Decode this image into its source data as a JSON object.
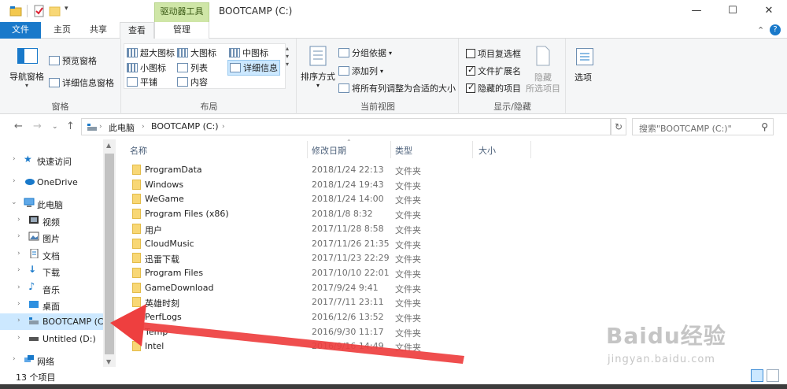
{
  "titlebar": {
    "context_tool": "驱动器工具",
    "title": "BOOTCAMP (C:)",
    "minimize_icon": "minimize-icon",
    "maximize_icon": "maximize-icon",
    "close_icon": "close-icon"
  },
  "tabs": {
    "file": "文件",
    "home": "主页",
    "share": "共享",
    "view": "查看",
    "manage": "管理"
  },
  "ribbon": {
    "panes": {
      "nav_pane": "导航窗格",
      "preview_pane": "预览窗格",
      "details_pane": "详细信息窗格",
      "label": "窗格"
    },
    "layout": {
      "extra_large": "超大图标",
      "large": "大图标",
      "medium": "中图标",
      "small": "小图标",
      "list": "列表",
      "details": "详细信息",
      "tiles": "平铺",
      "content": "内容",
      "label": "布局"
    },
    "current_view": {
      "sort_by": "排序方式",
      "group_by": "分组依据",
      "add_columns": "添加列",
      "fit_columns": "将所有列调整为合适的大小",
      "label": "当前视图"
    },
    "show_hide": {
      "item_checkboxes": "项目复选框",
      "item_checkboxes_checked": false,
      "file_extensions": "文件扩展名",
      "file_extensions_checked": true,
      "hidden_items": "隐藏的项目",
      "hidden_items_checked": true,
      "hide": "隐藏",
      "hide_selected": "所选项目",
      "label": "显示/隐藏"
    },
    "options": "选项"
  },
  "address": {
    "crumb_pc": "此电脑",
    "crumb_drive": "BOOTCAMP (C:)",
    "search_placeholder": "搜索\"BOOTCAMP (C:)\""
  },
  "nav": {
    "quick_access": "快速访问",
    "onedrive": "OneDrive",
    "this_pc": "此电脑",
    "videos": "视频",
    "pictures": "图片",
    "documents": "文档",
    "downloads": "下载",
    "music": "音乐",
    "desktop": "桌面",
    "bootcamp": "BOOTCAMP (C",
    "untitled": "Untitled (D:)",
    "network": "网络"
  },
  "columns": {
    "name": "名称",
    "date": "修改日期",
    "type": "类型",
    "size": "大小"
  },
  "files": [
    {
      "name": "ProgramData",
      "date": "2018/1/24 22:13",
      "type": "文件夹"
    },
    {
      "name": "Windows",
      "date": "2018/1/24 19:43",
      "type": "文件夹"
    },
    {
      "name": "WeGame",
      "date": "2018/1/24 14:00",
      "type": "文件夹"
    },
    {
      "name": "Program Files (x86)",
      "date": "2018/1/8 8:32",
      "type": "文件夹"
    },
    {
      "name": "用户",
      "date": "2017/11/28 8:58",
      "type": "文件夹"
    },
    {
      "name": "CloudMusic",
      "date": "2017/11/26 21:35",
      "type": "文件夹"
    },
    {
      "name": "迅雷下载",
      "date": "2017/11/23 22:29",
      "type": "文件夹"
    },
    {
      "name": "Program Files",
      "date": "2017/10/10 22:01",
      "type": "文件夹"
    },
    {
      "name": "GameDownload",
      "date": "2017/9/24 9:41",
      "type": "文件夹"
    },
    {
      "name": "英雄时刻",
      "date": "2017/7/11 23:11",
      "type": "文件夹"
    },
    {
      "name": "PerfLogs",
      "date": "2016/12/6 13:52",
      "type": "文件夹"
    },
    {
      "name": "Temp",
      "date": "2016/9/30 11:17",
      "type": "文件夹"
    },
    {
      "name": "Intel",
      "date": "2016/9/16 14:49",
      "type": "文件夹"
    }
  ],
  "status": {
    "count": "13 个项目"
  },
  "watermark": {
    "logo": "Baidu经验",
    "site": "jingyan.baidu.com"
  },
  "colors": {
    "file_tab": "#1979ca",
    "context_tool": "#cfe6a7",
    "selection": "#cce8ff",
    "folder": "#f8d775",
    "arrow": "#ee3f3f"
  }
}
